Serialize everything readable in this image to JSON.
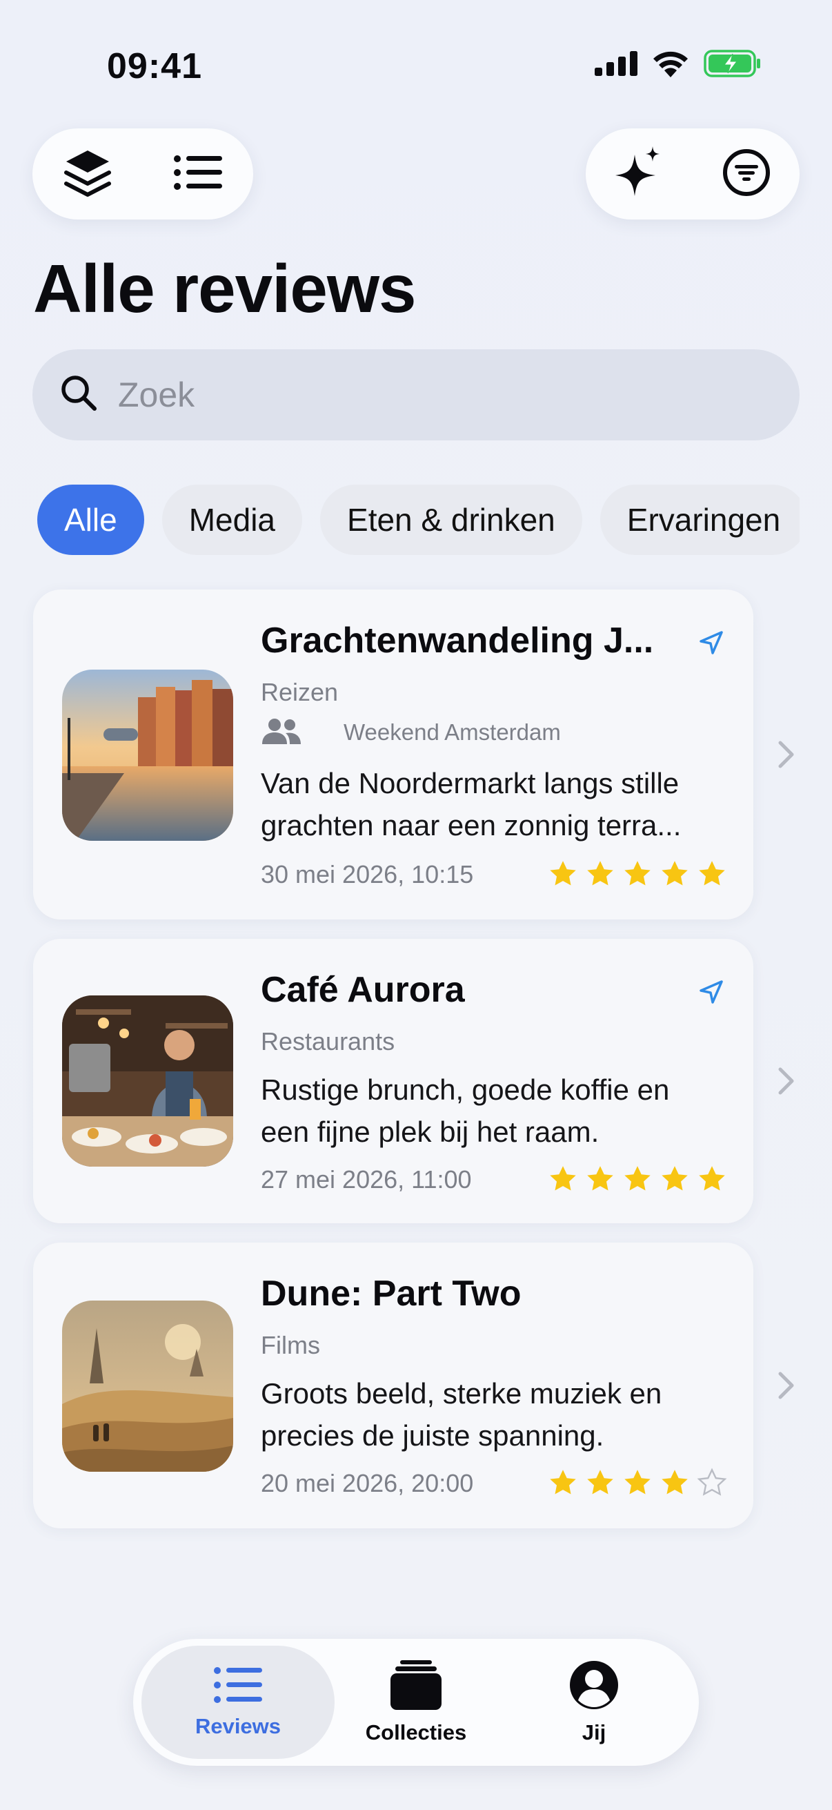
{
  "status": {
    "time": "09:41"
  },
  "toolbar": {
    "left": [
      "layers-icon",
      "list-icon"
    ],
    "right": [
      "sparkles-icon",
      "filter-icon"
    ]
  },
  "page_title": "Alle reviews",
  "search": {
    "placeholder": "Zoek",
    "value": ""
  },
  "chips": [
    {
      "label": "Alle",
      "active": true
    },
    {
      "label": "Media",
      "active": false
    },
    {
      "label": "Eten & drinken",
      "active": false
    },
    {
      "label": "Ervaringen",
      "active": false
    }
  ],
  "reviews": [
    {
      "title": "Grachtenwandeling J...",
      "category": "Reizen",
      "collection": "Weekend Amsterdam",
      "body_lines": [
        "Van de Noordermarkt langs stille",
        "grachten naar een zonnig terra..."
      ],
      "date": "30 mei 2026, 10:15",
      "rating": 5,
      "has_location": true
    },
    {
      "title": "Café Aurora",
      "category": "Restaurants",
      "body_lines": [
        "Rustige brunch, goede koffie en",
        "een fijne plek bij het raam."
      ],
      "date": "27 mei 2026, 11:00",
      "rating": 5,
      "has_location": true
    },
    {
      "title": "Dune: Part Two",
      "category": "Films",
      "body_lines": [
        "Groots beeld, sterke muziek en",
        "precies de juiste spanning."
      ],
      "date": "20 mei 2026, 20:00",
      "rating": 4,
      "has_location": false
    }
  ],
  "tabbar": [
    {
      "label": "Reviews",
      "icon": "list-icon",
      "active": true
    },
    {
      "label": "Collecties",
      "icon": "collections-icon",
      "active": false
    },
    {
      "label": "Jij",
      "icon": "person-icon",
      "active": false
    }
  ],
  "colors": {
    "accent": "#3d73e9",
    "star": "#f8c512",
    "location": "#2f8be6"
  }
}
